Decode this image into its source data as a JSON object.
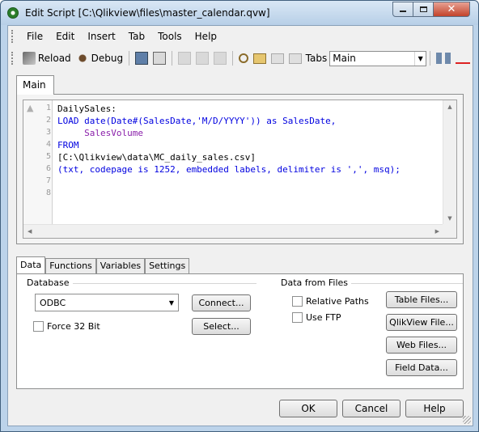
{
  "window": {
    "title": "Edit Script [C:\\Qlikview\\files\\master_calendar.qvw]",
    "minimize_icon": "minimize-icon",
    "maximize_icon": "maximize-icon",
    "close_glyph": "✕"
  },
  "menu": [
    "File",
    "Edit",
    "Insert",
    "Tab",
    "Tools",
    "Help"
  ],
  "toolbar": {
    "reload_label": "Reload",
    "debug_label": "Debug",
    "tabs_label": "Tabs",
    "tabs_value": "Main"
  },
  "editor": {
    "tab_label": "Main",
    "line_numbers": [
      "1",
      "2",
      "3",
      "4",
      "5",
      "6",
      "7",
      "8"
    ],
    "lines": [
      "DailySales:",
      "LOAD date(Date#(SalesDate,'M/D/YYYY')) as SalesDate,",
      "     SalesVolume",
      "FROM",
      "[C:\\Qlikview\\data\\MC_daily_sales.csv]",
      "(txt, codepage is 1252, embedded labels, delimiter is ',', msq);",
      "",
      ""
    ]
  },
  "panel": {
    "tabs": [
      "Data",
      "Functions",
      "Variables",
      "Settings"
    ],
    "database_label": "Database",
    "database_value": "ODBC",
    "connect_label": "Connect...",
    "select_label": "Select...",
    "force32_label": "Force 32 Bit",
    "data_from_files_label": "Data from Files",
    "relative_paths_label": "Relative Paths",
    "use_ftp_label": "Use FTP",
    "table_files_label": "Table Files...",
    "qlikview_file_label": "QlikView File...",
    "web_files_label": "Web Files...",
    "field_data_label": "Field Data..."
  },
  "footer": {
    "ok_label": "OK",
    "cancel_label": "Cancel",
    "help_label": "Help"
  }
}
